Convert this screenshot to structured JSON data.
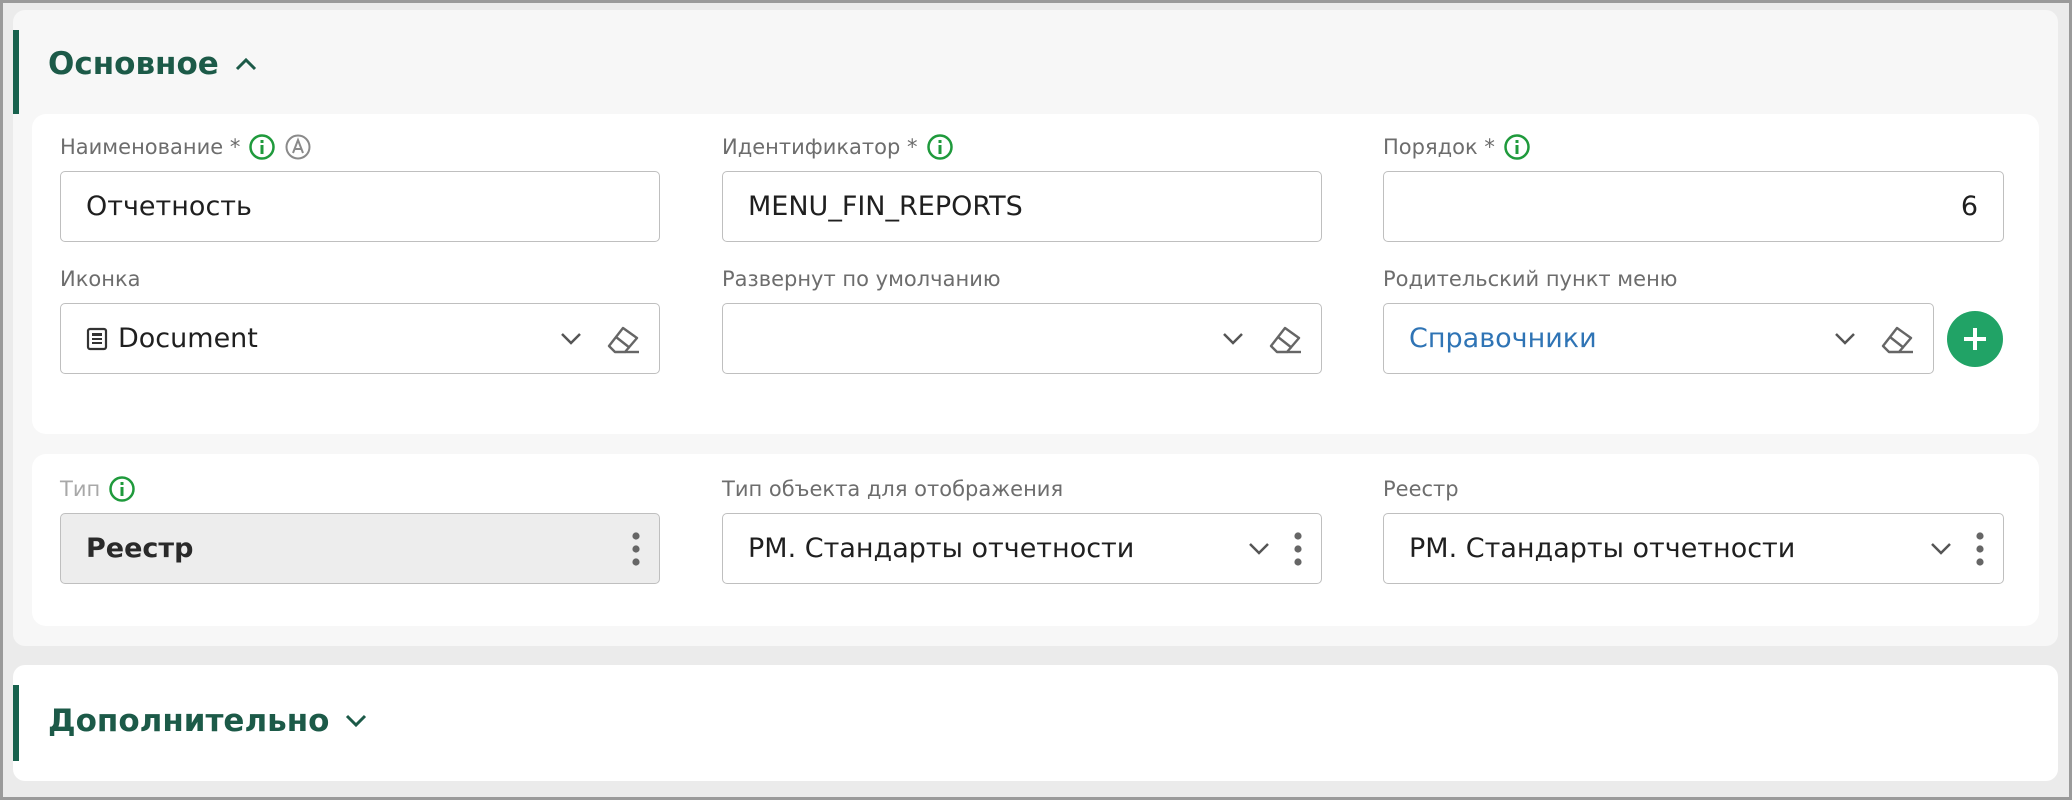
{
  "main_section": {
    "title": "Основное",
    "fields": {
      "name": {
        "label": "Наименование *",
        "value": "Отчетность"
      },
      "identifier": {
        "label": "Идентификатор *",
        "value": "MENU_FIN_REPORTS"
      },
      "order": {
        "label": "Порядок *",
        "value": "6"
      },
      "icon": {
        "label": "Иконка",
        "value": "Document",
        "icon": "document-icon"
      },
      "expanded_default": {
        "label": "Развернут по умолчанию",
        "value": ""
      },
      "parent_menu": {
        "label": "Родительский пункт меню",
        "value": "Справочники"
      },
      "type": {
        "label": "Тип",
        "value": "Реестр"
      },
      "display_object_type": {
        "label": "Тип объекта для отображения",
        "value": "РМ. Стандарты отчетности"
      },
      "registry": {
        "label": "Реестр",
        "value": "РМ. Стандарты отчетности"
      }
    }
  },
  "extra_section": {
    "title": "Дополнительно"
  },
  "colors": {
    "section_title": "#1c5a48",
    "info_icon": "#1f9a3c",
    "link": "#2f74b5",
    "add_button": "#21a366"
  }
}
